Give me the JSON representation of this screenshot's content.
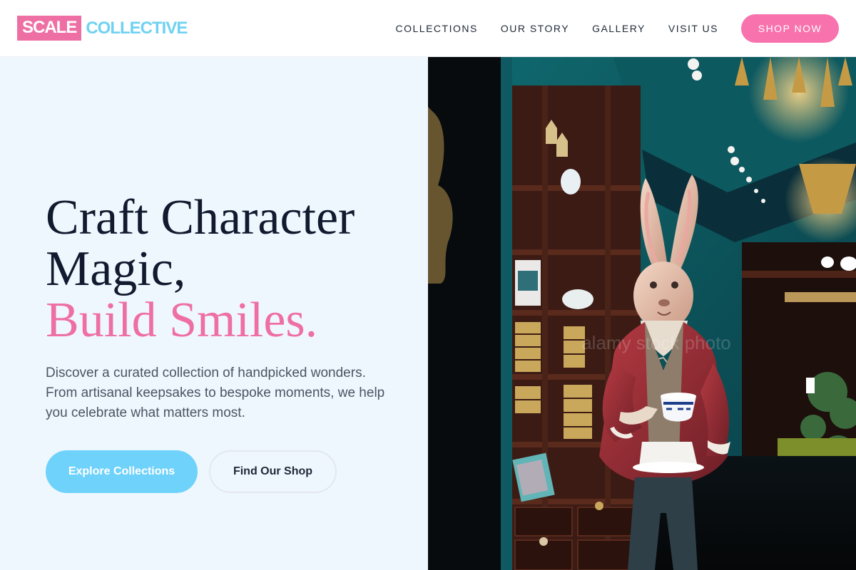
{
  "nav": {
    "logo_primary": "SCALE",
    "logo_secondary": "COLLECTIVE",
    "links": [
      "COLLECTIONS",
      "OUR STORY",
      "GALLERY",
      "VISIT US"
    ],
    "cta": "SHOP NOW"
  },
  "hero": {
    "headline_line1": "Craft Character",
    "headline_line2": "Magic,",
    "headline_line3": "Build Smiles.",
    "description": "Discover a curated collection of handpicked wonders. From artisanal keepsakes to bespoke moments, we help you celebrate what matters most.",
    "primary_button": "Explore Collections",
    "secondary_button": "Find Our Shop",
    "image_watermark": "alamy stock photo"
  },
  "colors": {
    "brand_pink": "#ee6fa4",
    "brand_cyan": "#6fd2f2",
    "hero_bg": "#eff7fe",
    "text_dark": "#111a2e"
  }
}
